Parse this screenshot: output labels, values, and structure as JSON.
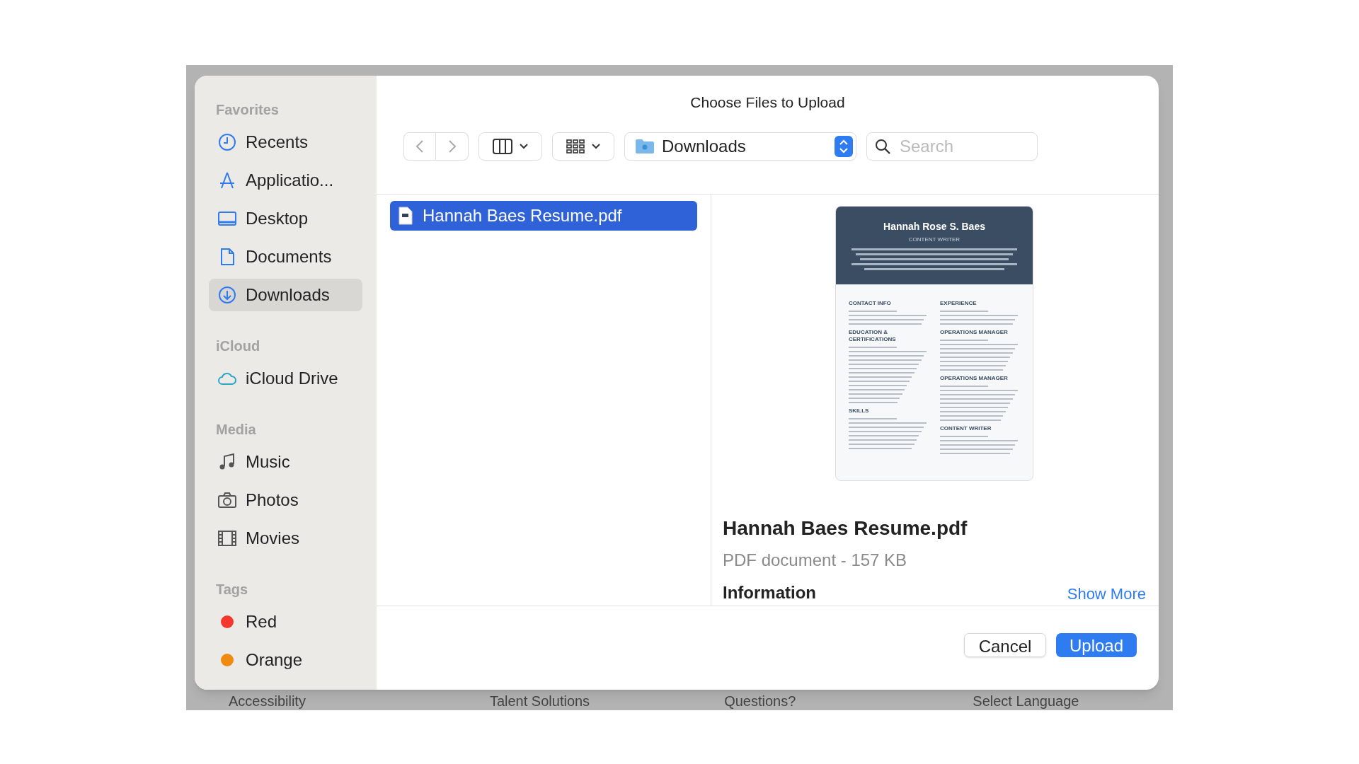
{
  "window": {
    "title": "Choose Files to Upload"
  },
  "toolbar": {
    "path": "Downloads",
    "search": {
      "placeholder": "Search"
    }
  },
  "sidebar": {
    "sections": [
      {
        "header": "Favorites",
        "items": [
          {
            "label": "Recents",
            "selected": false
          },
          {
            "label": "Applicatio...",
            "selected": false
          },
          {
            "label": "Desktop",
            "selected": false
          },
          {
            "label": "Documents",
            "selected": false
          },
          {
            "label": "Downloads",
            "selected": true
          }
        ]
      },
      {
        "header": "iCloud",
        "items": [
          {
            "label": "iCloud Drive",
            "selected": false
          }
        ]
      },
      {
        "header": "Media",
        "items": [
          {
            "label": "Music",
            "selected": false
          },
          {
            "label": "Photos",
            "selected": false
          },
          {
            "label": "Movies",
            "selected": false
          }
        ]
      },
      {
        "header": "Tags",
        "items": [
          {
            "label": "Red",
            "selected": false,
            "color": "#f4372c"
          },
          {
            "label": "Orange",
            "selected": false,
            "color": "#f08a10"
          }
        ]
      }
    ]
  },
  "files": [
    {
      "name": "Hannah Baes Resume.pdf",
      "selected": true
    }
  ],
  "preview": {
    "document": {
      "name": "Hannah Rose S. Baes",
      "role": "CONTENT WRITER",
      "left_sections": [
        "CONTACT INFO",
        "EDUCATION & CERTIFICATIONS",
        "SKILLS"
      ],
      "right_sections": [
        "EXPERIENCE",
        "OPERATIONS MANAGER",
        "OPERATIONS MANAGER",
        "CONTENT WRITER"
      ]
    },
    "filename": "Hannah Baes Resume.pdf",
    "details": "PDF document - 157 KB",
    "info_heading": "Information",
    "show_more": "Show More"
  },
  "buttons": {
    "cancel": "Cancel",
    "upload": "Upload"
  },
  "background_footer": [
    "Accessibility",
    "Talent Solutions",
    "Questions?",
    "Select Language"
  ]
}
